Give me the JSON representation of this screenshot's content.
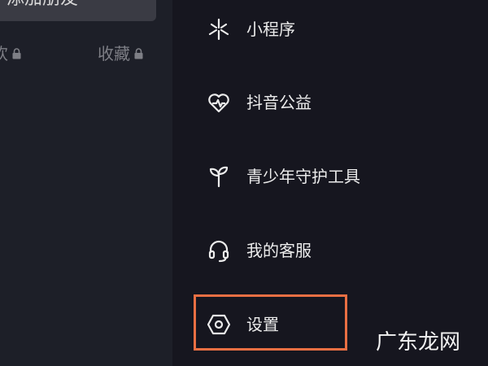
{
  "profile_bg": {
    "add_friend_label": "添加朋友",
    "tabs": [
      {
        "label": "欢",
        "locked": true
      },
      {
        "label": "收藏",
        "locked": true
      }
    ]
  },
  "menu": {
    "items": [
      {
        "label": "小程序",
        "icon": "mini-program-icon"
      },
      {
        "label": "抖音公益",
        "icon": "charity-heart-icon"
      },
      {
        "label": "青少年守护工具",
        "icon": "sprout-icon"
      },
      {
        "label": "我的客服",
        "icon": "headset-icon"
      },
      {
        "label": "设置",
        "icon": "settings-hexagon-icon",
        "highlighted": true
      }
    ]
  },
  "colors": {
    "background": "#16161f",
    "highlight_border": "#ea6f43",
    "notification_dot": "#e8c400"
  },
  "watermark": "广东龙网"
}
